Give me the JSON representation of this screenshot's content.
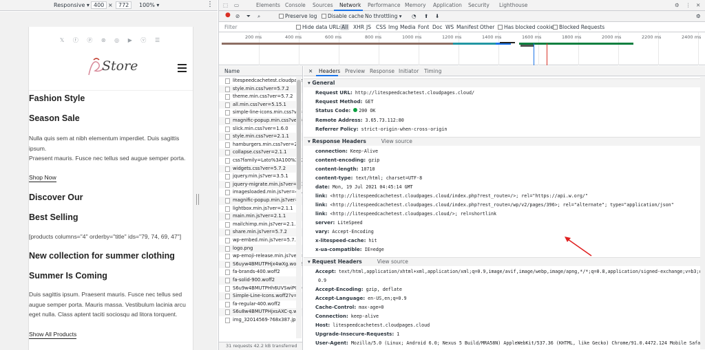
{
  "device_toolbar": {
    "device": "Responsive",
    "width": "400",
    "times": "×",
    "height": "772",
    "zoom": "100%",
    "more": "⋮"
  },
  "mobile_page": {
    "social_icons": [
      "twitter-icon",
      "facebook-icon",
      "pinterest-icon",
      "dribbble-icon",
      "instagram-icon",
      "youtube-icon",
      "vimeo-icon",
      "rss-icon"
    ],
    "social_text": "𝕏 ⓕ ⓟ ⊛ ◎ ▶ ⓥ ☰",
    "logo_text": "Store",
    "sections": [
      {
        "heading": "Fashion Style"
      },
      {
        "heading": "Season Sale"
      },
      {
        "para1": "Nulla quis sem at nibh elementum imperdiet. Duis sagittis ipsum.",
        "para2": "Praesent mauris. Fusce nec tellus sed augue semper porta.",
        "link": "Shop Now"
      },
      {
        "heading": "Discover Our"
      },
      {
        "heading": "Best Selling"
      },
      {
        "shortcode": "[products columns=\"4\" orderby=\"title\" ids=\"79, 74, 69, 47\"]"
      },
      {
        "heading": "New collection for summer clothing"
      },
      {
        "heading": "Summer Is Coming"
      },
      {
        "para": "Duis sagittis ipsum. Praesent mauris. Fusce nec tellus sed augue semper porta. Mauris massa. Vestibulum lacinia arcu eget nulla. Class aptent taciti sociosqu ad litora torquent.",
        "link": "Show All Products"
      }
    ]
  },
  "devtools": {
    "tabs": [
      "Elements",
      "Console",
      "Sources",
      "Network",
      "Performance",
      "Memory",
      "Application",
      "Security",
      "Lighthouse"
    ],
    "active_tab": "Network",
    "toolbar": {
      "preserve_log": "Preserve log",
      "disable_cache": "Disable cache",
      "throttling": "No throttling ▾"
    },
    "filter": {
      "placeholder": "Filter",
      "hide_data_urls": "Hide data URLs",
      "types": [
        "All",
        "XHR",
        "JS",
        "CSS",
        "Img",
        "Media",
        "Font",
        "Doc",
        "WS",
        "Manifest",
        "Other"
      ],
      "blocked_cookies": "Has blocked cookies",
      "blocked_requests": "Blocked Requests"
    },
    "overview_ticks": [
      "200 ms",
      "400 ms",
      "600 ms",
      "800 ms",
      "1000 ms",
      "1200 ms",
      "1400 ms",
      "1600 ms",
      "1800 ms",
      "2000 ms",
      "2200 ms",
      "2400 ms"
    ],
    "requests_header": "Name",
    "requests": [
      "litespeedcachetest.cloudpage",
      "style.min.css?ver=5.7.2",
      "theme.min.css?ver=5.7.2",
      "all.min.css?ver=5.15.1",
      "simple-line-icons.min.css?ver=",
      "magnific-popup.min.css?ver=5",
      "slick.min.css?ver=1.6.0",
      "style.min.css?ver=2.1.1",
      "hamburgers.min.css?ver=2.1.1",
      "collapse.css?ver=2.1.1",
      "css?family=Lato%3A100%2C2",
      "widgets.css?ver=5.7.2",
      "jquery.min.js?ver=3.5.1",
      "jquery-migrate.min.js?ver=3.3",
      "imagesloaded.min.js?ver=4.1.",
      "magnific-popup.min.js?ver=2.",
      "lightbox.min.js?ver=2.1.1",
      "main.min.js?ver=2.1.1",
      "mailchimp.min.js?ver=2.1.1",
      "share.min.js?ver=5.7.2",
      "wp-embed.min.js?ver=5.7.2",
      "logo.png",
      "wp-emoji-release.min.js?ver=5",
      "S6uyw4BMUTPHjx4wXg.woff2",
      "fa-brands-400.woff2",
      "fa-solid-900.woff2",
      "S6u9w4BMUTPHh6UVSwiPGQ",
      "Simple-Line-Icons.woff2?v=2.",
      "fa-regular-400.woff2",
      "S6u8w4BMUTPHjxsAXC-q.wof",
      "img_32014569-768x387.jpg"
    ],
    "requests_footer": "31 requests   42.2 kB transferred",
    "detail_tabs": [
      "Headers",
      "Preview",
      "Response",
      "Initiator",
      "Timing"
    ],
    "general": {
      "title": "General",
      "rows": [
        {
          "k": "Request URL:",
          "v": "http://litespeedcachetest.cloudpages.cloud/"
        },
        {
          "k": "Request Method:",
          "v": "GET"
        },
        {
          "k": "Status Code:",
          "v": "200 OK"
        },
        {
          "k": "Remote Address:",
          "v": "3.65.73.112:80"
        },
        {
          "k": "Referrer Policy:",
          "v": "strict-origin-when-cross-origin"
        }
      ]
    },
    "response_headers": {
      "title": "Response Headers",
      "view_source": "View source",
      "rows": [
        {
          "k": "connection:",
          "v": "Keep-Alive"
        },
        {
          "k": "content-encoding:",
          "v": "gzip"
        },
        {
          "k": "content-length:",
          "v": "10710"
        },
        {
          "k": "content-type:",
          "v": "text/html; charset=UTF-8"
        },
        {
          "k": "date:",
          "v": "Mon, 19 Jul 2021 04:45:14 GMT"
        },
        {
          "k": "link:",
          "v": "<http://litespeedcachetest.cloudpages.cloud/index.php?rest_route=/>; rel=\"https://api.w.org/\""
        },
        {
          "k": "link:",
          "v": "<http://litespeedcachetest.cloudpages.cloud/index.php?rest_route=/wp/v2/pages/396>; rel=\"alternate\"; type=\"application/json\""
        },
        {
          "k": "link:",
          "v": "<http://litespeedcachetest.cloudpages.cloud/>; rel=shortlink"
        },
        {
          "k": "server:",
          "v": "LiteSpeed"
        },
        {
          "k": "vary:",
          "v": "Accept-Encoding"
        },
        {
          "k": "x-litespeed-cache:",
          "v": "hit"
        },
        {
          "k": "x-ua-compatible:",
          "v": "IE=edge"
        }
      ]
    },
    "request_headers": {
      "title": "Request Headers",
      "view_source": "View source",
      "rows": [
        {
          "k": "Accept:",
          "v": "text/html,application/xhtml+xml,application/xml;q=0.9,image/avif,image/webp,image/apng,*/*;q=0.8,application/signed-exchange;v=b3;q="
        },
        {
          "k": "",
          "v": "0.9"
        },
        {
          "k": "Accept-Encoding:",
          "v": "gzip, deflate"
        },
        {
          "k": "Accept-Language:",
          "v": "en-US,en;q=0.9"
        },
        {
          "k": "Cache-Control:",
          "v": "max-age=0"
        },
        {
          "k": "Connection:",
          "v": "keep-alive"
        },
        {
          "k": "Host:",
          "v": "litespeedcachetest.cloudpages.cloud"
        },
        {
          "k": "Upgrade-Insecure-Requests:",
          "v": "1"
        },
        {
          "k": "User-Agent:",
          "v": "Mozilla/5.0 (Linux; Android 6.0; Nexus 5 Build/MRA58N) AppleWebKit/537.36 (KHTML, like Gecko) Chrome/91.0.4472.124 Mobile Safari/"
        }
      ]
    },
    "colors": {
      "accent": "#1a73e8",
      "arrow": "#e02020",
      "status_ok": "#0a9f3f",
      "record": "#d93025"
    }
  }
}
